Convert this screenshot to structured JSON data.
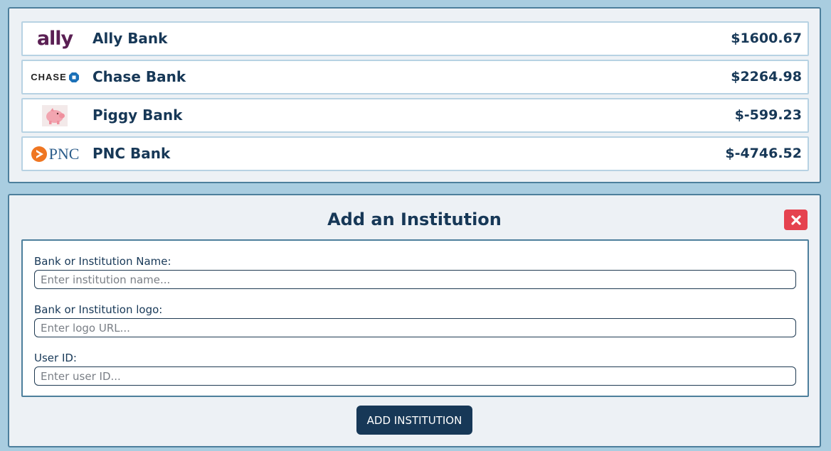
{
  "accounts": [
    {
      "name": "Ally Bank",
      "balance": "$1600.67",
      "logo_text": "ally",
      "logo_icon": "ally-logo"
    },
    {
      "name": "Chase Bank",
      "balance": "$2264.98",
      "logo_text": "CHASE",
      "logo_icon": "chase-octagon-logo"
    },
    {
      "name": "Piggy Bank",
      "balance": "$-599.23",
      "logo_text": "",
      "logo_icon": "piggy-bank-icon"
    },
    {
      "name": "PNC Bank",
      "balance": "$-4746.52",
      "logo_text": "PNC",
      "logo_icon": "pnc-logo"
    }
  ],
  "add_form": {
    "title": "Add an Institution",
    "close_icon": "close-icon",
    "name_label": "Bank or Institution Name:",
    "name_placeholder": "Enter institution name...",
    "name_value": "",
    "logo_label": "Bank or Institution logo:",
    "logo_placeholder": "Enter logo URL...",
    "logo_value": "",
    "user_label": "User ID:",
    "user_placeholder": "Enter user ID...",
    "user_value": "",
    "submit_label": "ADD INSTITUTION"
  },
  "colors": {
    "background": "#a9cde0",
    "panel": "#edf1f5",
    "text_dark": "#173857",
    "close_red": "#e5424f",
    "ally_purple": "#5a1f53",
    "pnc_orange": "#ef7622",
    "pnc_blue": "#2c5d8a"
  }
}
